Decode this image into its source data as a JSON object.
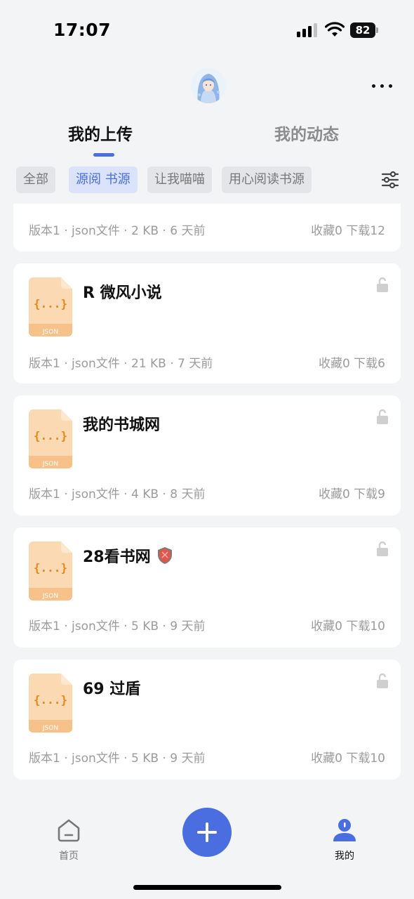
{
  "status_bar": {
    "time": "17:07",
    "battery": "82"
  },
  "header": {
    "tabs": [
      {
        "label": "我的上传",
        "active": true
      },
      {
        "label": "我的动态",
        "active": false
      }
    ]
  },
  "filters": [
    {
      "label": "全部",
      "selected": false
    },
    {
      "label": "源阅 书源",
      "selected": true
    },
    {
      "label": "让我喵喵",
      "selected": false
    },
    {
      "label": "用心阅读书源",
      "selected": false
    }
  ],
  "partial_card": {
    "meta": "版本1 · json文件 · 2 KB · 6 天前",
    "stats": "收藏0 下载12"
  },
  "cards": [
    {
      "title": "R 微风小说",
      "meta": "版本1 · json文件 · 21 KB · 7 天前",
      "stats": "收藏0 下载6",
      "file_braces": "{...}",
      "file_type": "JSON"
    },
    {
      "title": "我的书城网",
      "meta": "版本1 · json文件 · 4 KB · 8 天前",
      "stats": "收藏0 下载9",
      "file_braces": "{...}",
      "file_type": "JSON"
    },
    {
      "title": "28看书网",
      "meta": "版本1 · json文件 · 5 KB · 9 天前",
      "stats": "收藏0 下载10",
      "file_braces": "{...}",
      "file_type": "JSON",
      "emoji": "shield-icon"
    },
    {
      "title": "69 过盾",
      "meta": "版本1 · json文件 · 5 KB · 9 天前",
      "stats": "收藏0 下载10",
      "file_braces": "{...}",
      "file_type": "JSON"
    }
  ],
  "bottom_nav": {
    "home_label": "首页",
    "mine_label": "我的"
  },
  "colors": {
    "accent": "#4a6ee0",
    "file_icon": "#fbd9b3",
    "file_icon_band": "#f7c18a",
    "file_text": "#e08a1e",
    "background": "#f3f4f6"
  },
  "icons": [
    "signal-icon",
    "wifi-icon",
    "battery-icon",
    "more-icon",
    "filter-icon",
    "json-file-icon",
    "lock-icon",
    "shield-icon",
    "home-icon",
    "plus-icon",
    "user-icon"
  ]
}
